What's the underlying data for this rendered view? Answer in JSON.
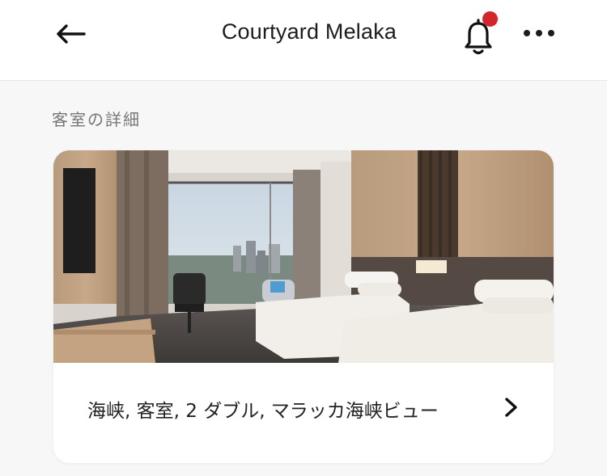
{
  "header": {
    "title": "Courtyard Melaka",
    "back_icon": "arrow-left-icon",
    "bell_icon": "bell-icon",
    "notification_dot_color": "#d0262c",
    "more_icon": "more-horizontal-icon"
  },
  "section": {
    "label": "客室の詳細"
  },
  "room": {
    "name": "海峡, 客室, 2 ダブル, マラッカ海峡ビュー",
    "image": "hotel-room-photo",
    "chevron_icon": "chevron-right-icon"
  }
}
